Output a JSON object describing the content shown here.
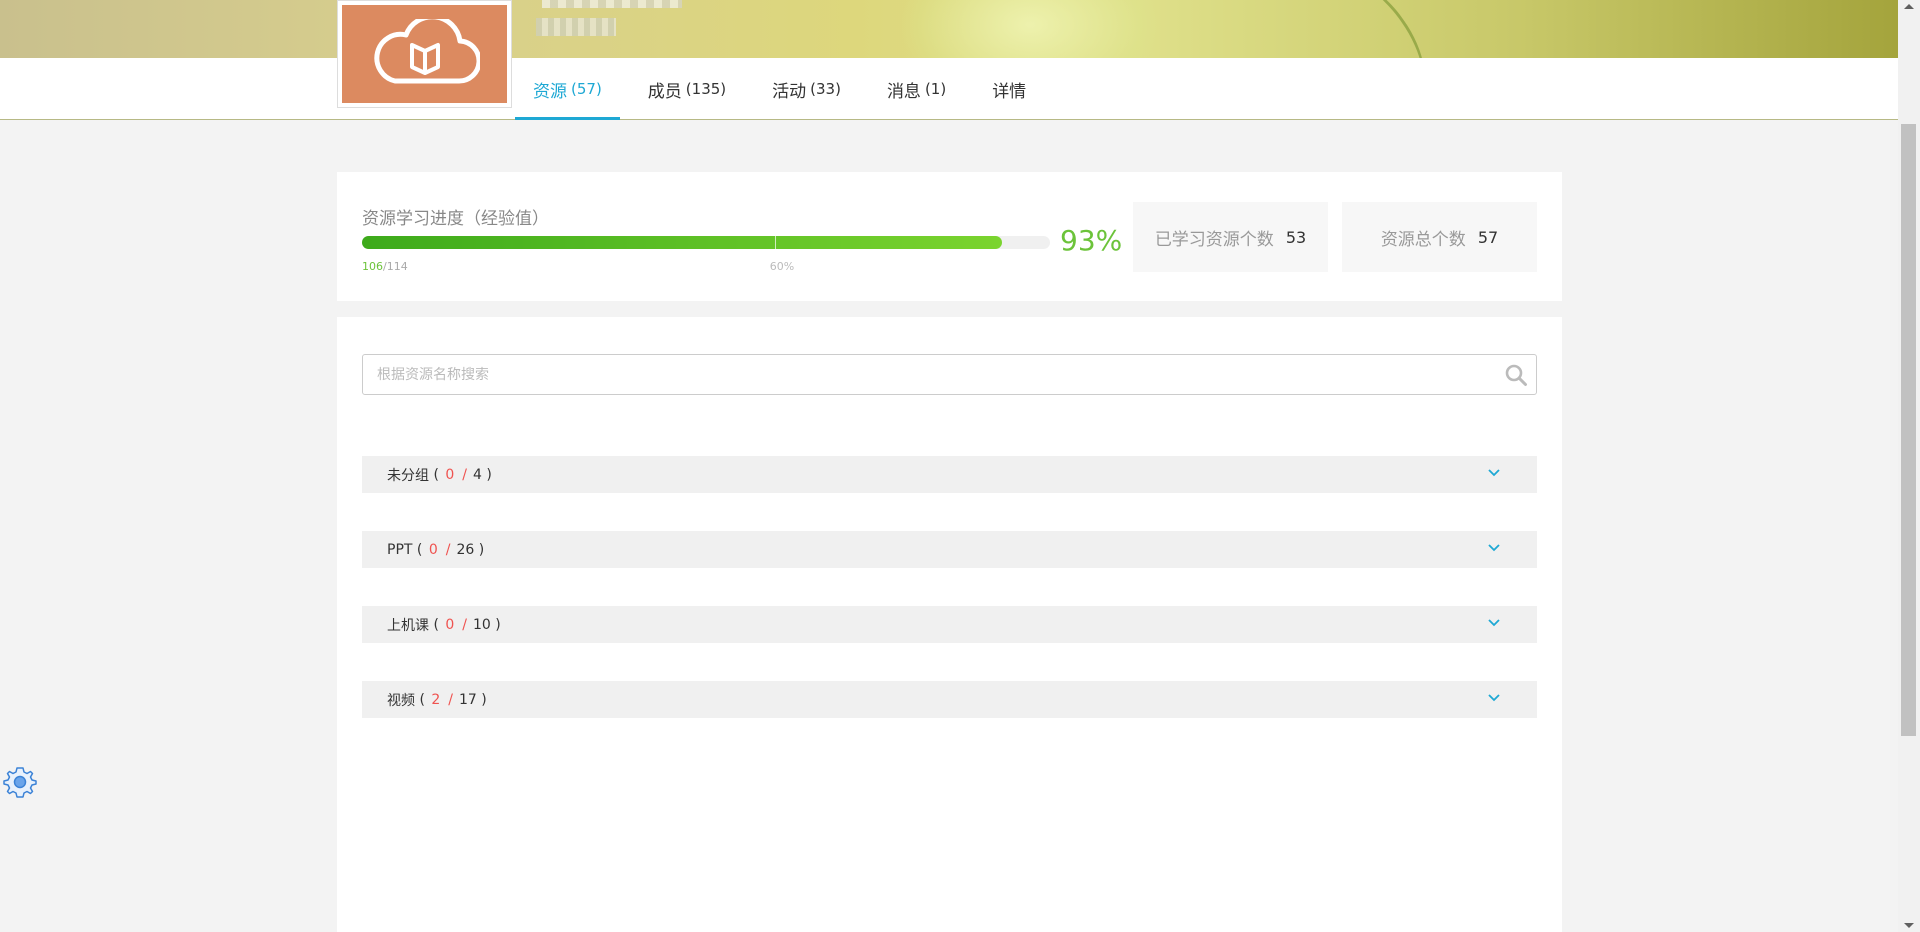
{
  "tabs": [
    {
      "label": "资源",
      "count": "(57)",
      "active": true
    },
    {
      "label": "成员",
      "count": "(135)",
      "active": false
    },
    {
      "label": "活动",
      "count": "(33)",
      "active": false
    },
    {
      "label": "消息",
      "count": "(1)",
      "active": false
    },
    {
      "label": "详情",
      "count": "",
      "active": false
    }
  ],
  "progress": {
    "title": "资源学习进度（经验值）",
    "current": "106",
    "total": "/114",
    "fill_percent": 93,
    "threshold_percent": 60,
    "threshold_label": "60%",
    "percent_label": "93%"
  },
  "stats": {
    "learned_label": "已学习资源个数",
    "learned_value": "53",
    "total_label": "资源总个数",
    "total_value": "57"
  },
  "search": {
    "placeholder": "根据资源名称搜索"
  },
  "groups": [
    {
      "name": "未分组",
      "done": "0",
      "total": "4"
    },
    {
      "name": "PPT",
      "done": "0",
      "total": "26"
    },
    {
      "name": "上机课",
      "done": "0",
      "total": "10"
    },
    {
      "name": "视频",
      "done": "2",
      "total": "17"
    }
  ],
  "colors": {
    "accent": "#1ea8d4",
    "progress_green": "#6cc33a",
    "count_red": "#ef5350",
    "logo_bg": "#dc8a60"
  },
  "icons": {
    "logo": "cloud-book-icon",
    "search": "search-icon",
    "expand": "chevron-down-icon",
    "settings": "gear-icon"
  }
}
